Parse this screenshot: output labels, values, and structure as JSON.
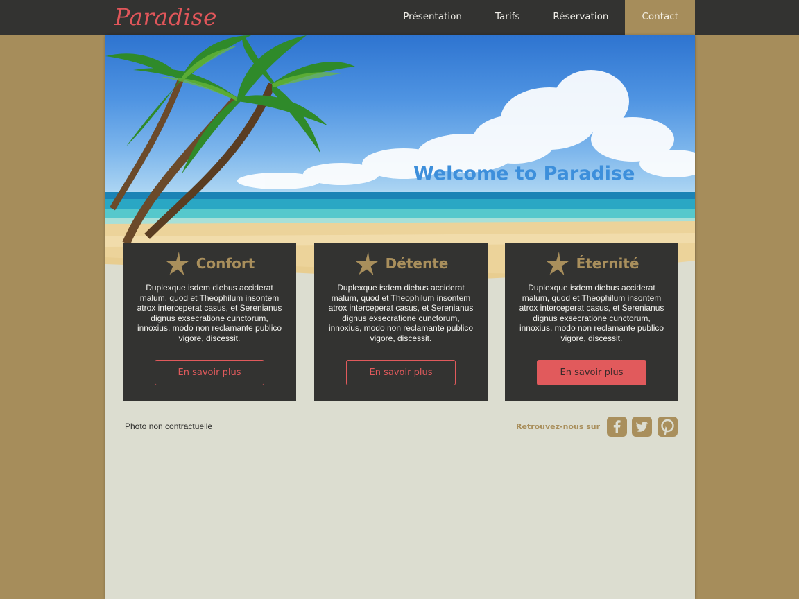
{
  "header": {
    "logo_text": "Paradise",
    "nav": [
      {
        "label": "Présentation"
      },
      {
        "label": "Tarifs"
      },
      {
        "label": "Réservation"
      },
      {
        "label": "Contact",
        "active": true
      }
    ]
  },
  "hero": {
    "title": "Welcome to Paradise"
  },
  "cards": [
    {
      "title": "Confort",
      "icon": "star-icon",
      "text": "Duplexque isdem diebus acciderat malum, quod et Theophilum insontem atrox interceperat casus, et Serenianus dignus exsecratione cunctorum, innoxius, modo non reclamante publico vigore, discessit.",
      "button": "En savoir plus"
    },
    {
      "title": "Détente",
      "icon": "star-icon",
      "text": "Duplexque isdem diebus acciderat malum, quod et Theophilum insontem atrox interceperat casus, et Serenianus dignus exsecratione cunctorum, innoxius, modo non reclamante publico vigore, discessit.",
      "button": "En savoir plus"
    },
    {
      "title": "Éternité",
      "icon": "star-icon",
      "text": "Duplexque isdem diebus acciderat malum, quod et Theophilum insontem atrox interceperat casus, et Serenianus dignus exsecratione cunctorum, innoxius, modo non reclamante publico vigore, discessit.",
      "button": "En savoir plus"
    }
  ],
  "footer": {
    "note": "Photo non contractuelle",
    "social_label": "Retrouvez-nous sur",
    "social": [
      {
        "icon": "facebook-icon"
      },
      {
        "icon": "twitter-icon"
      },
      {
        "icon": "pinterest-icon"
      }
    ]
  },
  "colors": {
    "background": "#a68d5b",
    "topbar": "#333331",
    "accent_red": "#e15a5c",
    "accent_gold": "#a98f5c",
    "page": "#dcddd0",
    "hero_title": "#3d8fdb"
  }
}
